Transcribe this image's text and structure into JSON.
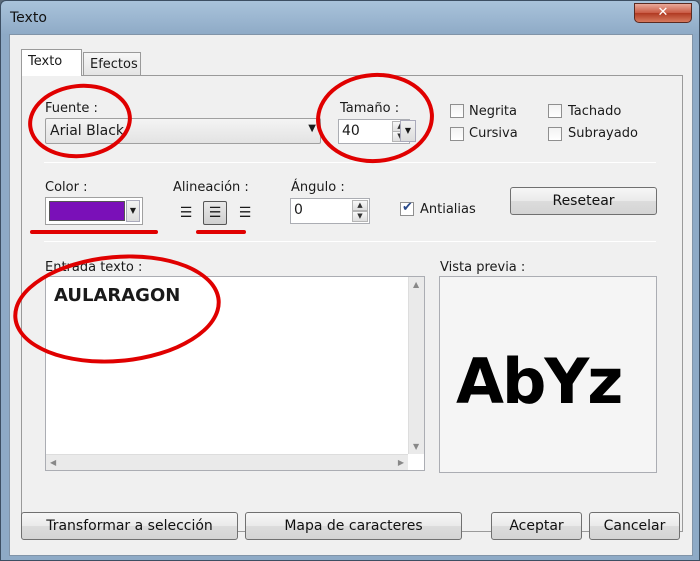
{
  "window": {
    "title": "Texto",
    "close_glyph": "✕"
  },
  "tabs": [
    {
      "label": "Texto",
      "active": true
    },
    {
      "label": "Efectos",
      "active": false
    }
  ],
  "font": {
    "label": "Fuente :",
    "value": "Arial Black"
  },
  "size": {
    "label": "Tamaño :",
    "value": "40"
  },
  "styles": {
    "bold": {
      "label": "Negrita",
      "checked": false
    },
    "italic": {
      "label": "Cursiva",
      "checked": false
    },
    "strike": {
      "label": "Tachado",
      "checked": false
    },
    "underline": {
      "label": "Subrayado",
      "checked": false
    }
  },
  "color": {
    "label": "Color :",
    "value": "#7a10b8"
  },
  "alignment": {
    "label": "Alineación :",
    "options": [
      "left",
      "center",
      "right"
    ],
    "selected": "center"
  },
  "angle": {
    "label": "Ángulo :",
    "value": "0"
  },
  "antialias": {
    "label": "Antialias",
    "checked": true
  },
  "reset_button": "Resetear",
  "text_input": {
    "label": "Entrada texto :",
    "value": "AULARAGON"
  },
  "preview": {
    "label": "Vista previa :",
    "sample": "AbYz"
  },
  "buttons": {
    "transform": "Transformar a selección",
    "char_map": "Mapa de caracteres",
    "accept": "Aceptar",
    "cancel": "Cancelar"
  },
  "annotation_color": "#e00000",
  "icons": {
    "dropdown": "chevron-down-icon",
    "spin_up": "spin-up-icon",
    "spin_down": "spin-down-icon",
    "align_left": "align-left-icon",
    "align_center": "align-center-icon",
    "align_right": "align-right-icon"
  }
}
